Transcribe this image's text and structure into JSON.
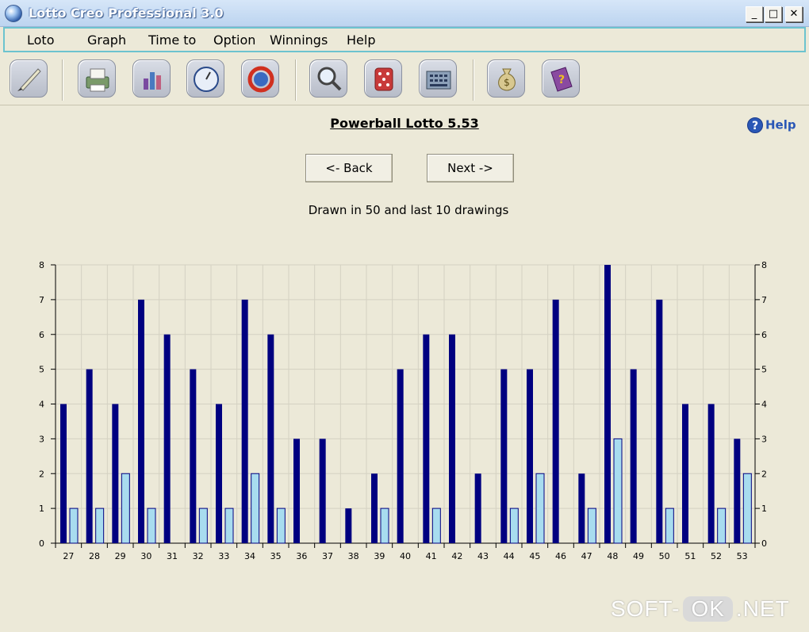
{
  "window": {
    "title": "Lotto Creo Professional 3.0",
    "minimize": "_",
    "maximize": "□",
    "close": "✕"
  },
  "menu": [
    {
      "label": "Loto"
    },
    {
      "label": "Graph"
    },
    {
      "label": "Time to"
    },
    {
      "label": "Option"
    },
    {
      "label": "Winnings"
    },
    {
      "label": "Help"
    }
  ],
  "toolbar": [
    {
      "icon": "pen-icon"
    },
    {
      "icon": "print-icon"
    },
    {
      "icon": "chart-icon"
    },
    {
      "icon": "clock-icon"
    },
    {
      "icon": "refresh-icon"
    },
    {
      "icon": "magnifier-icon"
    },
    {
      "icon": "dice-icon"
    },
    {
      "icon": "calculator-icon"
    },
    {
      "icon": "moneybag-icon"
    },
    {
      "icon": "book-icon"
    }
  ],
  "page": {
    "title": "Powerball Lotto 5.53",
    "help": "Help",
    "back": "<- Back",
    "next": "Next ->",
    "subtitle": "Drawn in 50 and last 10 drawings"
  },
  "watermark": {
    "left": "SOFT-",
    "mid": "OK",
    "right": ".NET"
  },
  "chart_data": {
    "type": "bar",
    "categories": [
      "27",
      "28",
      "29",
      "30",
      "31",
      "32",
      "33",
      "34",
      "35",
      "36",
      "37",
      "38",
      "39",
      "40",
      "41",
      "42",
      "43",
      "44",
      "45",
      "46",
      "47",
      "48",
      "49",
      "50",
      "51",
      "52",
      "53"
    ],
    "series": [
      {
        "values": [
          4,
          5,
          4,
          7,
          6,
          5,
          4,
          7,
          6,
          3,
          3,
          1,
          2,
          5,
          6,
          6,
          2,
          5,
          5,
          7,
          2,
          8,
          5,
          7,
          4,
          4,
          3
        ]
      },
      {
        "values": [
          1,
          1,
          2,
          1,
          0,
          1,
          1,
          2,
          1,
          0,
          0,
          0,
          1,
          0,
          1,
          0,
          0,
          1,
          2,
          0,
          1,
          3,
          0,
          1,
          0,
          1,
          2
        ]
      }
    ],
    "ylim": [
      0,
      8
    ],
    "yticks": [
      "0",
      "1",
      "2",
      "3",
      "4",
      "5",
      "6",
      "7",
      "8"
    ],
    "grid": true,
    "colors": {
      "series1": "#000080",
      "series2": "#a8dcef",
      "grid": "#d4d1c2"
    }
  }
}
